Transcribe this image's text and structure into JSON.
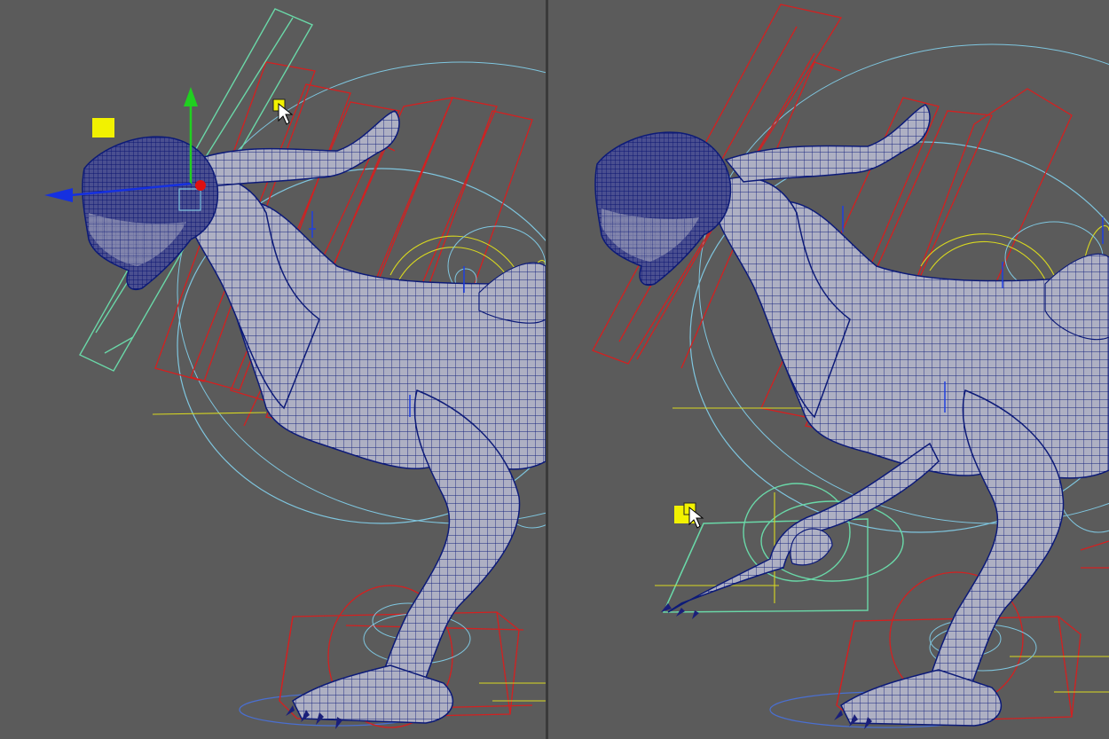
{
  "viewports": [
    {
      "id": "left",
      "selected_control": "head",
      "gizmo": "move-manipulator",
      "cursor": "select-cursor"
    },
    {
      "id": "right",
      "selected_control": "front-leg",
      "gizmo": "none",
      "cursor": "select-cursor"
    }
  ],
  "colors": {
    "background": "#5b5b5b",
    "mesh_fill": "#a9aabd",
    "mesh_wire": "#0c1a78",
    "control_red": "#d42020",
    "control_green": "#6ad8a8",
    "control_cyan": "#7fc6df",
    "control_yellow": "#d8d820",
    "handle_yellow": "#f2f200",
    "gizmo_x": "#1530e0",
    "gizmo_y": "#20d020",
    "gizmo_center": "#e01010"
  }
}
